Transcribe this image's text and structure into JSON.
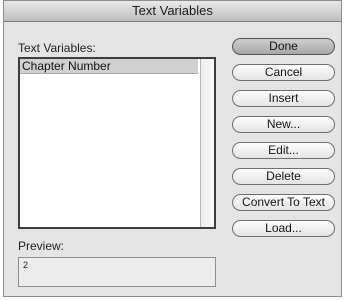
{
  "window": {
    "title": "Text Variables"
  },
  "list": {
    "label": "Text Variables:",
    "items": [
      {
        "label": "Chapter Number",
        "selected": true
      }
    ]
  },
  "preview": {
    "label": "Preview:",
    "value": "2"
  },
  "buttons": {
    "done": "Done",
    "cancel": "Cancel",
    "insert": "Insert",
    "new": "New...",
    "edit": "Edit...",
    "delete": "Delete",
    "convert": "Convert To Text",
    "load": "Load..."
  }
}
